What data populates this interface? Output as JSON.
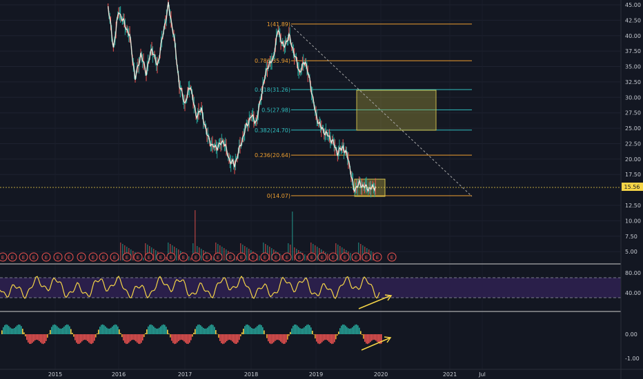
{
  "chart_data": {
    "type": "line",
    "instrument_panel": "candlestick price with fibonacci retracement, volume, RSI and histogram oscillator",
    "colors": {
      "background": "#131722",
      "grid": "#1e2230",
      "price_up": "#26a69a",
      "price_down": "#ef5350",
      "price_line": "#e8e4d8",
      "fib_orange": "#f0a030",
      "fib_teal": "#30c0c0",
      "rsi_line": "#f5d547",
      "rsi_band": "#2a1f4a",
      "last_price_badge": "#f5d547",
      "trend_arrow": "#f5d547"
    },
    "y_ticks": [
      "45.00",
      "42.50",
      "40.00",
      "37.50",
      "35.00",
      "32.50",
      "30.00",
      "27.50",
      "25.00",
      "22.50",
      "20.00",
      "17.50",
      "12.50",
      "10.00",
      "7.50",
      "5.00"
    ],
    "rsi_ticks": [
      "80.00",
      "40.00"
    ],
    "osc_ticks": [
      "0.00",
      "-1.00"
    ],
    "x_ticks": [
      "2015",
      "2016",
      "2017",
      "2018",
      "2019",
      "2020",
      "2021",
      "Jul"
    ],
    "last_price": "15.56",
    "fib_levels": [
      {
        "label": "1(41.89)",
        "value": 41.89,
        "color": "#f0a030"
      },
      {
        "label": "0.786(35.94)",
        "value": 35.94,
        "color": "#f0a030"
      },
      {
        "label": "0.618(31.26)",
        "value": 31.26,
        "color": "#30c0c0"
      },
      {
        "label": "0.5(27.98)",
        "value": 27.98,
        "color": "#30c0c0"
      },
      {
        "label": "0.382(24.70)",
        "value": 24.7,
        "color": "#30c0c0"
      },
      {
        "label": "0.236(20.64)",
        "value": 20.64,
        "color": "#f0a030"
      },
      {
        "label": "0(14.07)",
        "value": 14.07,
        "color": "#f0a030"
      }
    ],
    "price_series": {
      "name": "",
      "points": [
        [
          "2015-11",
          45
        ],
        [
          "2015-12",
          38
        ],
        [
          "2016-01",
          44
        ],
        [
          "2016-02",
          42
        ],
        [
          "2016-03",
          40
        ],
        [
          "2016-04",
          33
        ],
        [
          "2016-05",
          37
        ],
        [
          "2016-06",
          34
        ],
        [
          "2016-07",
          38
        ],
        [
          "2016-08",
          35
        ],
        [
          "2016-09",
          40
        ],
        [
          "2016-10",
          45
        ],
        [
          "2016-11",
          40
        ],
        [
          "2016-12",
          32
        ],
        [
          "2017-01",
          29
        ],
        [
          "2017-02",
          32
        ],
        [
          "2017-03",
          27
        ],
        [
          "2017-04",
          28
        ],
        [
          "2017-05",
          24
        ],
        [
          "2017-06",
          22
        ],
        [
          "2017-07",
          22
        ],
        [
          "2017-08",
          23
        ],
        [
          "2017-09",
          20
        ],
        [
          "2017-10",
          19
        ],
        [
          "2017-11",
          22
        ],
        [
          "2017-12",
          25
        ],
        [
          "2018-01",
          27
        ],
        [
          "2018-02",
          26
        ],
        [
          "2018-03",
          31
        ],
        [
          "2018-04",
          35
        ],
        [
          "2018-05",
          36
        ],
        [
          "2018-06",
          41
        ],
        [
          "2018-07",
          38
        ],
        [
          "2018-08",
          40
        ],
        [
          "2018-09",
          37
        ],
        [
          "2018-10",
          34
        ],
        [
          "2018-11",
          36
        ],
        [
          "2018-12",
          32
        ],
        [
          "2019-01",
          27
        ],
        [
          "2019-02",
          25
        ],
        [
          "2019-03",
          24
        ],
        [
          "2019-04",
          23
        ],
        [
          "2019-05",
          21
        ],
        [
          "2019-06",
          22
        ],
        [
          "2019-07",
          20
        ],
        [
          "2019-08",
          15
        ],
        [
          "2019-09",
          16
        ],
        [
          "2019-10",
          15.5
        ],
        [
          "2019-11",
          15.2
        ],
        [
          "2019-12",
          15.56
        ]
      ]
    },
    "rsi_series": {
      "name": "",
      "range": [
        30,
        80
      ]
    },
    "annotations": [
      "E"
    ]
  }
}
